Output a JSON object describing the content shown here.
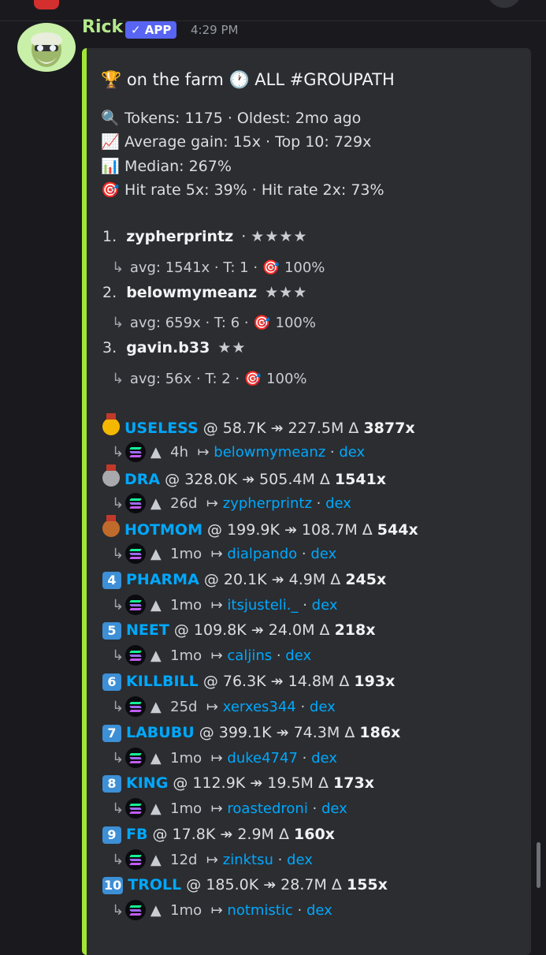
{
  "message": {
    "author": "Rick",
    "badge": "✓ APP",
    "timestamp": "4:29 PM"
  },
  "embed": {
    "title": "🏆 on the farm 🕐 ALL #GROUPATH",
    "stats": [
      "Tokens: 1175 · Oldest: 2mo ago",
      "Average gain: 15x · Top 10: 729x",
      "Median: 267%",
      "Hit rate 5x: 39% · Hit rate 2x: 73%"
    ],
    "leaderboard": [
      {
        "rank": "1.",
        "name": "zypherprintz",
        "stars": "★★★★",
        "stats": "avg: 1541x · T: 1 ·",
        "hit": "100%"
      },
      {
        "rank": "2.",
        "name": "belowmymeanz",
        "stars": "★★★",
        "stats": "avg: 659x · T: 6 ·",
        "hit": "100%"
      },
      {
        "rank": "3.",
        "name": "gavin.b33",
        "stars": "★★",
        "stats": "avg: 56x · T: 2 ·",
        "hit": "100%"
      }
    ],
    "tokens": [
      {
        "rank": "1",
        "name": "USELESS",
        "range": "@ 58.7K ↠ 227.5M Δ",
        "mult": "3877x",
        "age": "4h",
        "caller": "belowmymeanz",
        "dex": "dex"
      },
      {
        "rank": "2",
        "name": "DRA",
        "range": "@ 328.0K ↠ 505.4M Δ",
        "mult": "1541x",
        "age": "26d",
        "caller": "zypherprintz",
        "dex": "dex"
      },
      {
        "rank": "3",
        "name": "HOTMOM",
        "range": "@ 199.9K ↠ 108.7M Δ",
        "mult": "544x",
        "age": "1mo",
        "caller": "dialpando",
        "dex": "dex"
      },
      {
        "rank": "4",
        "name": "PHARMA",
        "range": "@ 20.1K ↠ 4.9M Δ",
        "mult": "245x",
        "age": "1mo",
        "caller": "itsjusteli._",
        "dex": "dex"
      },
      {
        "rank": "5",
        "name": "NEET",
        "range": "@ 109.8K ↠ 24.0M Δ",
        "mult": "218x",
        "age": "1mo",
        "caller": "caljins",
        "dex": "dex"
      },
      {
        "rank": "6",
        "name": "KILLBILL",
        "range": "@ 76.3K ↠ 14.8M Δ",
        "mult": "193x",
        "age": "25d",
        "caller": "xerxes344",
        "dex": "dex"
      },
      {
        "rank": "7",
        "name": "LABUBU",
        "range": "@ 399.1K ↠ 74.3M Δ",
        "mult": "186x",
        "age": "1mo",
        "caller": "duke4747",
        "dex": "dex"
      },
      {
        "rank": "8",
        "name": "KING",
        "range": "@ 112.9K ↠ 19.5M Δ",
        "mult": "173x",
        "age": "1mo",
        "caller": "roastedroni",
        "dex": "dex"
      },
      {
        "rank": "9",
        "name": "FB",
        "range": "@ 17.8K ↠ 2.9M Δ",
        "mult": "160x",
        "age": "12d",
        "caller": "zinktsu",
        "dex": "dex"
      },
      {
        "rank": "10",
        "name": "TROLL",
        "range": "@ 185.0K ↠ 28.7M Δ",
        "mult": "155x",
        "age": "1mo",
        "caller": "notmistic",
        "dex": "dex"
      }
    ]
  }
}
